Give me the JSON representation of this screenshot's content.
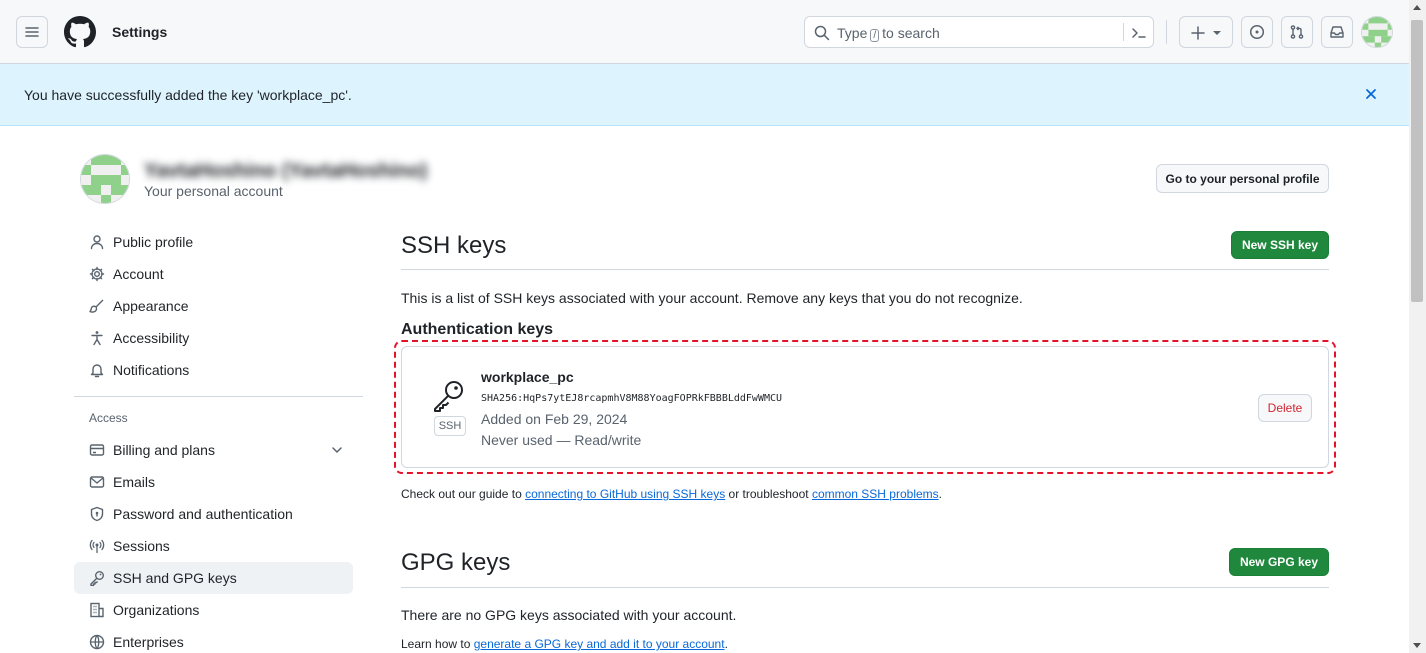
{
  "header": {
    "title": "Settings",
    "search_before": "Type",
    "search_slash": "/",
    "search_after": "to search"
  },
  "flash": {
    "message": "You have successfully added the key 'workplace_pc'.",
    "close_icon": "x-icon"
  },
  "user": {
    "name": "YavtaHoshino (YavtaHoshino)",
    "subtitle": "Your personal account",
    "profile_button": "Go to your personal profile"
  },
  "sidebar": {
    "items_top": [
      {
        "label": "Public profile",
        "icon": "person-icon"
      },
      {
        "label": "Account",
        "icon": "gear-icon"
      },
      {
        "label": "Appearance",
        "icon": "paintbrush-icon"
      },
      {
        "label": "Accessibility",
        "icon": "accessibility-icon"
      },
      {
        "label": "Notifications",
        "icon": "bell-icon"
      }
    ],
    "access_heading": "Access",
    "items_access": [
      {
        "label": "Billing and plans",
        "icon": "credit-card-icon"
      },
      {
        "label": "Emails",
        "icon": "mail-icon"
      },
      {
        "label": "Password and authentication",
        "icon": "shield-lock-icon"
      },
      {
        "label": "Sessions",
        "icon": "broadcast-icon"
      },
      {
        "label": "SSH and GPG keys",
        "icon": "key-icon"
      },
      {
        "label": "Organizations",
        "icon": "organization-icon"
      },
      {
        "label": "Enterprises",
        "icon": "globe-icon"
      }
    ],
    "active": "SSH and GPG keys"
  },
  "ssh": {
    "title": "SSH keys",
    "new_button": "New SSH key",
    "description": "This is a list of SSH keys associated with your account. Remove any keys that you do not recognize.",
    "auth_title": "Authentication keys",
    "key": {
      "badge": "SSH",
      "name": "workplace_pc",
      "fingerprint": "SHA256:HqPs7ytEJ8rcapmhV8M88YoagFOPRkFBBBLddFwWMCU",
      "added": "Added on Feb 29, 2024",
      "usage": "Never used — Read/write",
      "delete_button": "Delete"
    },
    "guide_prefix": "Check out our guide to",
    "guide_link1": "connecting to GitHub using SSH keys",
    "guide_middle": "or troubleshoot",
    "guide_link2": "common SSH problems",
    "guide_suffix": "."
  },
  "gpg": {
    "title": "GPG keys",
    "new_button": "New GPG key",
    "empty": "There are no GPG keys associated with your account.",
    "learn_prefix": "Learn how to",
    "learn_link": "generate a GPG key and add it to your account",
    "learn_suffix": "."
  },
  "colors": {
    "accent": "#0969da",
    "primary_button": "#1f883d",
    "danger": "#d1242f",
    "flash_bg": "#ddf4ff",
    "highlight": "#e5132a"
  }
}
